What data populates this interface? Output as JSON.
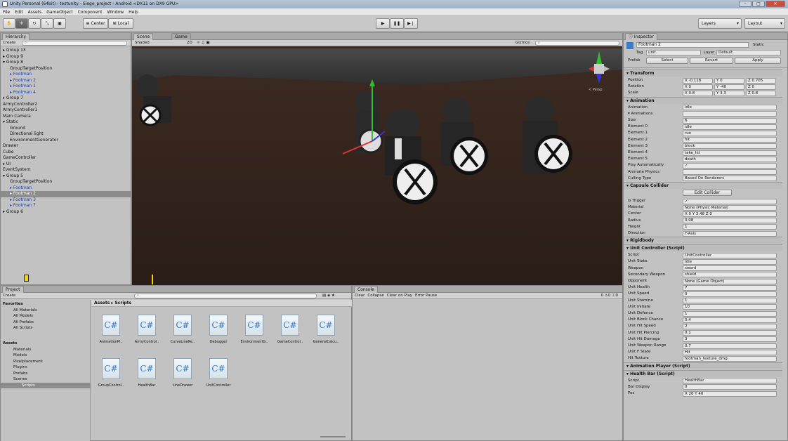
{
  "window": {
    "title": "Unity Personal (64bit) - testunity - Siege_project - Android <DX11 on DX9 GPU>"
  },
  "menu": [
    "File",
    "Edit",
    "Assets",
    "GameObject",
    "Component",
    "Window",
    "Help"
  ],
  "toolbar": {
    "pivot": "Center",
    "space": "Local",
    "layers": "Layers",
    "layout": "Layout"
  },
  "hierarchy": {
    "tab": "Hierarchy",
    "create": "Create",
    "items": [
      {
        "t": "▸ Group 13",
        "cls": "",
        "ind": 0
      },
      {
        "t": "▸ Group 9",
        "cls": "",
        "ind": 0
      },
      {
        "t": "▾ Group 8",
        "cls": "",
        "ind": 0
      },
      {
        "t": "GroupTargetPosition",
        "cls": "",
        "ind": 1
      },
      {
        "t": "▸ Footman",
        "cls": "blue",
        "ind": 1
      },
      {
        "t": "▸ Footman 2",
        "cls": "blue",
        "ind": 1
      },
      {
        "t": "▸ Footman 1",
        "cls": "blue",
        "ind": 1
      },
      {
        "t": "▸ Footman 4",
        "cls": "blue",
        "ind": 1
      },
      {
        "t": "▸ Group 7",
        "cls": "",
        "ind": 0
      },
      {
        "t": "ArmyController2",
        "cls": "",
        "ind": 0
      },
      {
        "t": "ArmyController1",
        "cls": "",
        "ind": 0
      },
      {
        "t": "Main Camera",
        "cls": "",
        "ind": 0
      },
      {
        "t": "▾ Static",
        "cls": "",
        "ind": 0
      },
      {
        "t": "Ground",
        "cls": "",
        "ind": 1
      },
      {
        "t": "Directional light",
        "cls": "",
        "ind": 1
      },
      {
        "t": "EnvironmentGenerator",
        "cls": "",
        "ind": 1
      },
      {
        "t": "Drawer",
        "cls": "",
        "ind": 0
      },
      {
        "t": "Cube",
        "cls": "",
        "ind": 0
      },
      {
        "t": "GameController",
        "cls": "",
        "ind": 0
      },
      {
        "t": "▸ UI",
        "cls": "",
        "ind": 0
      },
      {
        "t": "EventSystem",
        "cls": "",
        "ind": 0
      },
      {
        "t": "▾ Group 5",
        "cls": "",
        "ind": 0
      },
      {
        "t": "GroupTargetPosition",
        "cls": "",
        "ind": 1
      },
      {
        "t": "▸ Footman",
        "cls": "blue",
        "ind": 1
      },
      {
        "t": "▸ Footman 2",
        "cls": "sel",
        "ind": 1
      },
      {
        "t": "▸ Footman 3",
        "cls": "blue",
        "ind": 1
      },
      {
        "t": "▸ Footman 7",
        "cls": "blue",
        "ind": 1
      },
      {
        "t": "▸ Group 6",
        "cls": "",
        "ind": 0
      }
    ]
  },
  "scene": {
    "tab_scene": "Scene",
    "tab_game": "Game",
    "shading": "Shaded",
    "mode2d": "2D",
    "gizmos": "Gizmos",
    "persp": "< Persp"
  },
  "project": {
    "tab": "Project",
    "create": "Create",
    "favorites": [
      "Favorites",
      "All Materials",
      "All Models",
      "All Prefabs",
      "All Scripts"
    ],
    "assets": [
      "Assets",
      "Materials",
      "Models",
      "Pixelplacement",
      "Plugins",
      "Prefabs",
      "Scenes",
      "Scripts"
    ],
    "breadcrumb": "Assets ▸ Scripts",
    "files": [
      "AnimationPl..",
      "ArmyControl..",
      "CurveLineRe..",
      "Debugger",
      "EnvironmentG..",
      "GameControl..",
      "GeneralCalcu..",
      "GroupControl..",
      "HealthBar",
      "LineDrawer",
      "UnitController"
    ]
  },
  "console": {
    "tab": "Console",
    "buttons": [
      "Clear",
      "Collapse",
      "Clear on Play",
      "Error Pause"
    ],
    "counts": [
      "0",
      "0",
      "0"
    ]
  },
  "inspector": {
    "tab": "Inspector",
    "name": "Footman 2",
    "static": "Static",
    "tag_label": "Tag",
    "tag": "unit",
    "layer_label": "Layer",
    "layer": "Default",
    "prefab": "Prefab",
    "select": "Select",
    "revert": "Revert",
    "apply": "Apply",
    "transform": {
      "title": "Transform",
      "rows": [
        [
          "Position",
          "X -0.118",
          "Y 0",
          "Z 0.705"
        ],
        [
          "Rotation",
          "X 0",
          "Y -40",
          "Z 0"
        ],
        [
          "Scale",
          "X 0.8",
          "Y 3.3",
          "Z 0.8"
        ]
      ]
    },
    "animation": {
      "title": "Animation",
      "rows": [
        [
          "Animation",
          "idle"
        ],
        [
          "▾ Animations",
          ""
        ],
        [
          "Size",
          "6"
        ],
        [
          "Element 0",
          "idle"
        ],
        [
          "Element 1",
          "run"
        ],
        [
          "Element 2",
          "hit"
        ],
        [
          "Element 3",
          "block"
        ],
        [
          "Element 4",
          "take_hit"
        ],
        [
          "Element 5",
          "death"
        ],
        [
          "Play Automatically",
          "✓"
        ],
        [
          "Animate Physics",
          ""
        ],
        [
          "Culling Type",
          "Based On Renderers"
        ]
      ]
    },
    "capsule": {
      "title": "Capsule Collider",
      "edit": "Edit Collider",
      "rows": [
        [
          "Is Trigger",
          "✓"
        ],
        [
          "Material",
          "None (Physic Material)"
        ],
        [
          "Center",
          "X 0   Y 3.48   Z 0"
        ],
        [
          "Radius",
          "0.08"
        ],
        [
          "Height",
          "1"
        ],
        [
          "Direction",
          "Y-Axis"
        ]
      ]
    },
    "rigidbody": {
      "title": "Rigidbody"
    },
    "unit": {
      "title": "Unit Controller (Script)",
      "rows": [
        [
          "Script",
          "UnitController"
        ],
        [
          "Unit State",
          "Idle"
        ],
        [
          "Weapon",
          "sword"
        ],
        [
          "Secondary Weapon",
          "shield"
        ],
        [
          "Opponent",
          "None (Game Object)"
        ],
        [
          "Unit Health",
          "7"
        ],
        [
          "Unit Speed",
          "0"
        ],
        [
          "Unit Stamina",
          "1"
        ],
        [
          "Unit Initiate",
          "10"
        ],
        [
          "Unit Defence",
          "1"
        ],
        [
          "Unit Block Chance",
          "0.4"
        ],
        [
          "Unit Hit Speed",
          "2"
        ],
        [
          "Unit Hit Piercing",
          "0.1"
        ],
        [
          "Unit Hit Damage",
          "3"
        ],
        [
          "Unit Weapon Range",
          "0.7"
        ],
        [
          "Unit F State",
          "Hit"
        ],
        [
          "Hit Texture",
          "footman_texture_dmg"
        ]
      ]
    },
    "animplayer": {
      "title": "Animation Player (Script)"
    },
    "healthbar": {
      "title": "Health Bar (Script)",
      "rows": [
        [
          "Script",
          "HealthBar"
        ],
        [
          "Bar Display",
          "0"
        ],
        [
          "Pos",
          "X 20   Y 40"
        ]
      ]
    }
  }
}
